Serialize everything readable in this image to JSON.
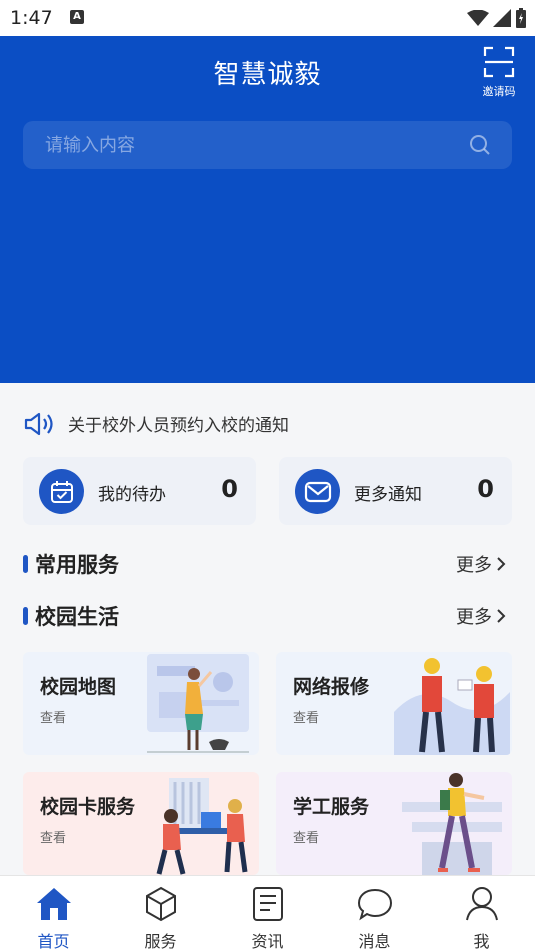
{
  "status": {
    "time": "1:47",
    "a_badge": "A"
  },
  "header": {
    "title": "智慧诚毅",
    "invite_label": "邀请码"
  },
  "search": {
    "placeholder": "请输入内容"
  },
  "notice": {
    "text": "关于校外人员预约入校的通知"
  },
  "cards": [
    {
      "label": "我的待办",
      "count": "0",
      "icon": "calendar-check-icon"
    },
    {
      "label": "更多通知",
      "count": "0",
      "icon": "mail-icon"
    }
  ],
  "sections": {
    "common": {
      "title": "常用服务",
      "more": "更多"
    },
    "campus": {
      "title": "校园生活",
      "more": "更多"
    }
  },
  "tiles": [
    {
      "title": "校园地图",
      "sub": "查看"
    },
    {
      "title": "网络报修",
      "sub": "查看"
    },
    {
      "title": "校园卡服务",
      "sub": "查看"
    },
    {
      "title": "学工服务",
      "sub": "查看"
    }
  ],
  "tabs": [
    {
      "label": "首页",
      "icon": "home-icon",
      "active": true
    },
    {
      "label": "服务",
      "icon": "cube-icon",
      "active": false
    },
    {
      "label": "资讯",
      "icon": "document-icon",
      "active": false
    },
    {
      "label": "消息",
      "icon": "chat-bubble-icon",
      "active": false
    },
    {
      "label": "我",
      "icon": "user-icon",
      "active": false
    }
  ],
  "colors": {
    "primary": "#0b4ec4",
    "accent": "#1f56c4"
  }
}
